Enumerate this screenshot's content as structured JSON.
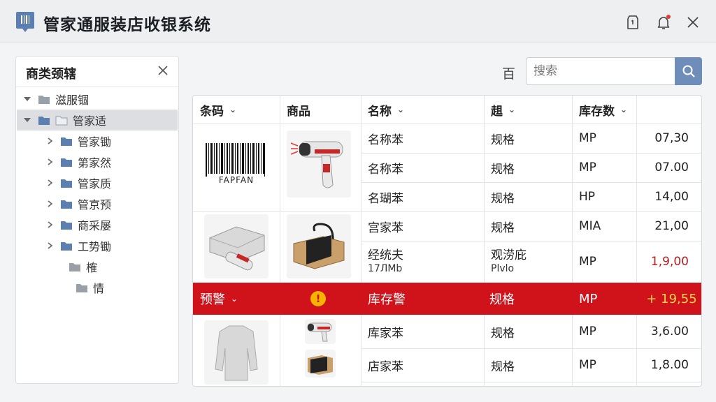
{
  "app": {
    "title": "管家通服装店收银系统"
  },
  "sidebar": {
    "title": "商类颈辖",
    "tree": [
      {
        "label": "滋服锢",
        "level": 0,
        "expanded": true
      },
      {
        "label": "管家适",
        "level": 0,
        "expanded": true,
        "selected": true
      },
      {
        "label": "管家锄",
        "level": 1
      },
      {
        "label": "第家然",
        "level": 1
      },
      {
        "label": "管家质",
        "level": 1
      },
      {
        "label": "管京预",
        "level": 1
      },
      {
        "label": "商采屡",
        "level": 1
      },
      {
        "label": "工势锄",
        "level": 1,
        "expanded": true
      },
      {
        "label": "榷",
        "level": 2
      },
      {
        "label": "情",
        "level": 3
      }
    ]
  },
  "toolbar": {
    "filter_glyph": "百",
    "search_placeholder": "搜索"
  },
  "table": {
    "columns": [
      "条码",
      "商品",
      "名称",
      "趄",
      "库存数",
      ""
    ],
    "barcode_text": "FAPFAN",
    "rows": [
      {
        "name": "名称苯",
        "spec": "规格",
        "unit": "MP",
        "value": "07,30"
      },
      {
        "name": "名称苯",
        "spec": "规格",
        "unit": "MP",
        "value": "07.00"
      },
      {
        "name": "名瑚苯",
        "spec": "规格",
        "unit": "HP",
        "value": "14,00"
      },
      {
        "name": "宫家苯",
        "spec": "规格",
        "unit": "MIA",
        "value": "21,00"
      },
      {
        "name": "经统夫",
        "name_sub": "17ЛMb",
        "spec": "观涝庇",
        "spec_sub": "Plvlo",
        "unit": "MP",
        "value": "1,9,00"
      }
    ],
    "alert_row": {
      "barcode": "预警",
      "icon": "!",
      "name": "库存警",
      "spec": "规格",
      "unit": "MP",
      "value": "+ 19,55"
    },
    "rows_after": [
      {
        "name": "库家苯",
        "spec": "规格",
        "unit": "MP",
        "value": "3,6.00"
      },
      {
        "name": "店家苯",
        "spec": "规格",
        "unit": "MP",
        "value": "1,8.00"
      }
    ]
  },
  "colors": {
    "accent": "#6e8db8",
    "alert": "#d0121b",
    "warning_icon": "#f4b400"
  }
}
